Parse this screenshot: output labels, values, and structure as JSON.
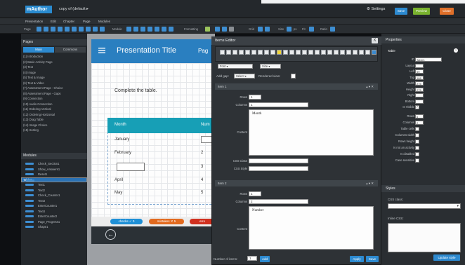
{
  "app": {
    "name": "Author",
    "logo_prefix": "m",
    "document": "copy of (default",
    "settings_label": "Settings"
  },
  "topbar": {
    "buttons": [
      {
        "label": "Save",
        "color": "#2d8ad0"
      },
      {
        "label": "Preview",
        "color": "#7ab32f"
      },
      {
        "label": "Close",
        "color": "#e0702a"
      }
    ]
  },
  "menu": [
    "Presentation",
    "Edit",
    "Chapter",
    "Page",
    "Modules"
  ],
  "toolbar": {
    "page_label": "Page",
    "module_label": "Module",
    "formatting_label": "Formatting",
    "grid_label": "Grid",
    "size_label": "Size",
    "fit_label": "Fit",
    "px_label": "px",
    "ratio_label": "Ratio"
  },
  "pages_panel": {
    "title": "Pages",
    "tabs": [
      "Main",
      "Commons"
    ],
    "items": [
      "(1) Introduction",
      "(2) Basic Activity Page",
      "(3) Text",
      "(4) Image",
      "(5) Text & Image",
      "(6) Text & Video",
      "(7) Assessment Page - Choice",
      "(8) Assessment Page - Gaps",
      "(9) Connection",
      "(10) Audio Connection",
      "(11) Ordering Vertical",
      "(12) Ordering Horizontal",
      "(13) Drag Table",
      "(14) Image Choice",
      "(15) Sorting"
    ]
  },
  "modules_panel": {
    "title": "Modules",
    "items": [
      "Check_Section1",
      "Show_Answers1",
      "Reset1",
      "Table1",
      "Text1",
      "Text2",
      "Check_Counter1",
      "Text3",
      "EnterCounter1",
      "Text4",
      "EnterCounter2",
      "Page_Progress1",
      "Shape1"
    ],
    "selected_index": 3
  },
  "slide": {
    "title": "Presentation Title",
    "page_label": "Pag",
    "instruction": "Complete the table.",
    "table_header": [
      "Month",
      "Num"
    ],
    "rows": [
      [
        "January",
        ""
      ],
      [
        "February",
        "2"
      ],
      [
        "",
        "3"
      ],
      [
        "April",
        "4"
      ],
      [
        "May",
        "5"
      ]
    ],
    "pills": [
      {
        "label": "checks",
        "count": "0",
        "color": "#1e8fd6"
      },
      {
        "label": "mistakes",
        "count": "5",
        "color": "#e26a1f"
      },
      {
        "label": "erro",
        "count": "",
        "color": "#d0301f"
      }
    ]
  },
  "editor": {
    "title": "Items Editor",
    "close": "X",
    "font_select": "Font",
    "size_select": "Size",
    "add_gap_label": "Add gap:",
    "gap_select": "Select",
    "rendered_view_label": "Rendered view:",
    "items": [
      {
        "header": "Item 1",
        "rows": "1",
        "columns": "1",
        "content": "Month",
        "css_class": "",
        "css_style": ""
      },
      {
        "header": "Item 2",
        "rows": "1",
        "columns": "2",
        "content": "Number"
      }
    ],
    "field_labels": {
      "rows": "Rows",
      "columns": "Columns",
      "content": "Content",
      "css_class": "CSS Class",
      "css_style": "CSS Style"
    },
    "number_of_items_label": "Number of items:",
    "number_of_items": "1",
    "add_label": "Add",
    "apply_label": "Apply",
    "save_label": "Save"
  },
  "properties": {
    "title": "Properties",
    "section": "Table",
    "fields": [
      {
        "label": "ID",
        "value": "Table1",
        "kind": "input"
      },
      {
        "label": "Layout",
        "value": "",
        "kind": "input"
      },
      {
        "label": "Left",
        "value": "59",
        "kind": "input"
      },
      {
        "label": "Top",
        "value": "168",
        "kind": "input"
      },
      {
        "label": "Width",
        "value": "275",
        "kind": "input"
      },
      {
        "label": "Height",
        "value": "275",
        "kind": "input"
      },
      {
        "label": "Right",
        "value": "",
        "kind": "input"
      },
      {
        "label": "Bottom",
        "value": "",
        "kind": "input"
      },
      {
        "label": "Is Visible",
        "value": "",
        "kind": "check"
      },
      {
        "label": "Rows",
        "value": "6",
        "kind": "input"
      },
      {
        "label": "Columns",
        "value": "2",
        "kind": "input"
      },
      {
        "label": "Table cells",
        "value": "",
        "kind": "check"
      },
      {
        "label": "Columns width",
        "value": "",
        "kind": "check"
      },
      {
        "label": "Rows height",
        "value": "",
        "kind": "check"
      },
      {
        "label": "Is not an activity",
        "value": "",
        "kind": "check"
      },
      {
        "label": "Is disabled",
        "value": "",
        "kind": "check"
      },
      {
        "label": "Case sensitive",
        "value": "",
        "kind": "check"
      }
    ],
    "styles_title": "Styles",
    "css_class_label": "CSS class:",
    "inline_css_label": "Inline CSS:",
    "update_style_label": "Update style"
  }
}
